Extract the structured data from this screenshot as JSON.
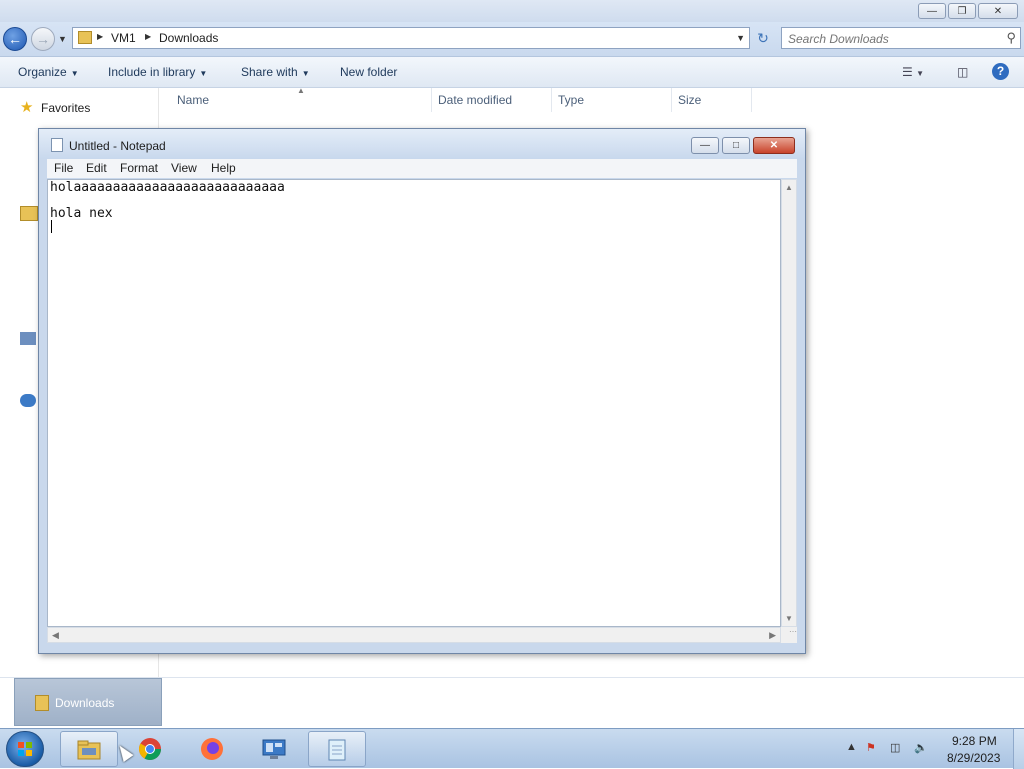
{
  "explorer": {
    "breadcrumb": [
      "VM1",
      "Downloads"
    ],
    "search_placeholder": "Search Downloads",
    "commands": [
      "Organize",
      "Include in library",
      "Share with",
      "New folder"
    ],
    "columns": [
      "Name",
      "Date modified",
      "Type",
      "Size"
    ],
    "nav": {
      "favorites": "Favorites"
    },
    "details_tile": "Downloads",
    "caption_buttons": [
      "minimize",
      "restore",
      "close"
    ]
  },
  "notepad": {
    "title": "Untitled - Notepad",
    "menu": [
      "File",
      "Edit",
      "Format",
      "View",
      "Help"
    ],
    "lines": [
      "holaaaaaaaaaaaaaaaaaaaaaaaaaaa",
      "",
      "hola nex"
    ]
  },
  "taskbar": {
    "pinned": [
      "explorer-icon",
      "chrome-icon",
      "firefox-icon",
      "remote-desktop-icon",
      "notepad-icon"
    ],
    "clock_time": "9:28 PM",
    "clock_date": "8/29/2023"
  },
  "colors": {
    "accent": "#2f6cc0",
    "window_frame": "#c9d8ec",
    "taskbar": "#a9c3e2"
  }
}
